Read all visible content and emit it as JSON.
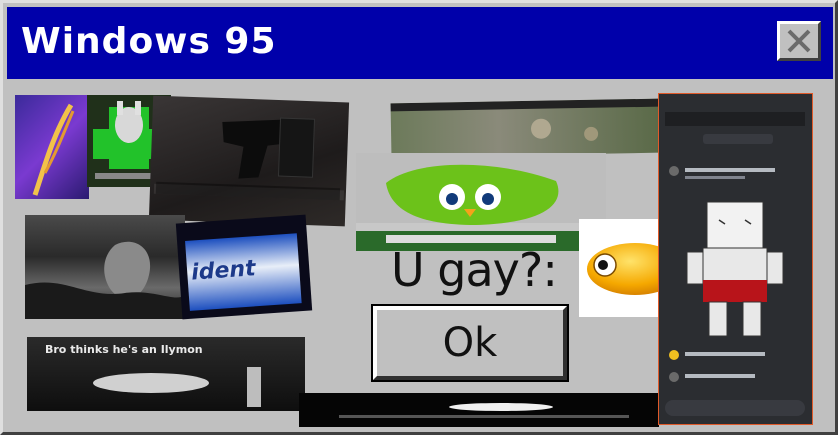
{
  "window": {
    "title": "Windows 95"
  },
  "dialog": {
    "prompt": "U gay?:",
    "ok_label": "Ok"
  },
  "collage": {
    "trident_text": "ident",
    "caption_2": "Bro thinks he's an Ilymon"
  },
  "icons": [
    "close-icon"
  ],
  "colors": {
    "titlebar": "#0000aa",
    "face": "#c0c0c0"
  }
}
